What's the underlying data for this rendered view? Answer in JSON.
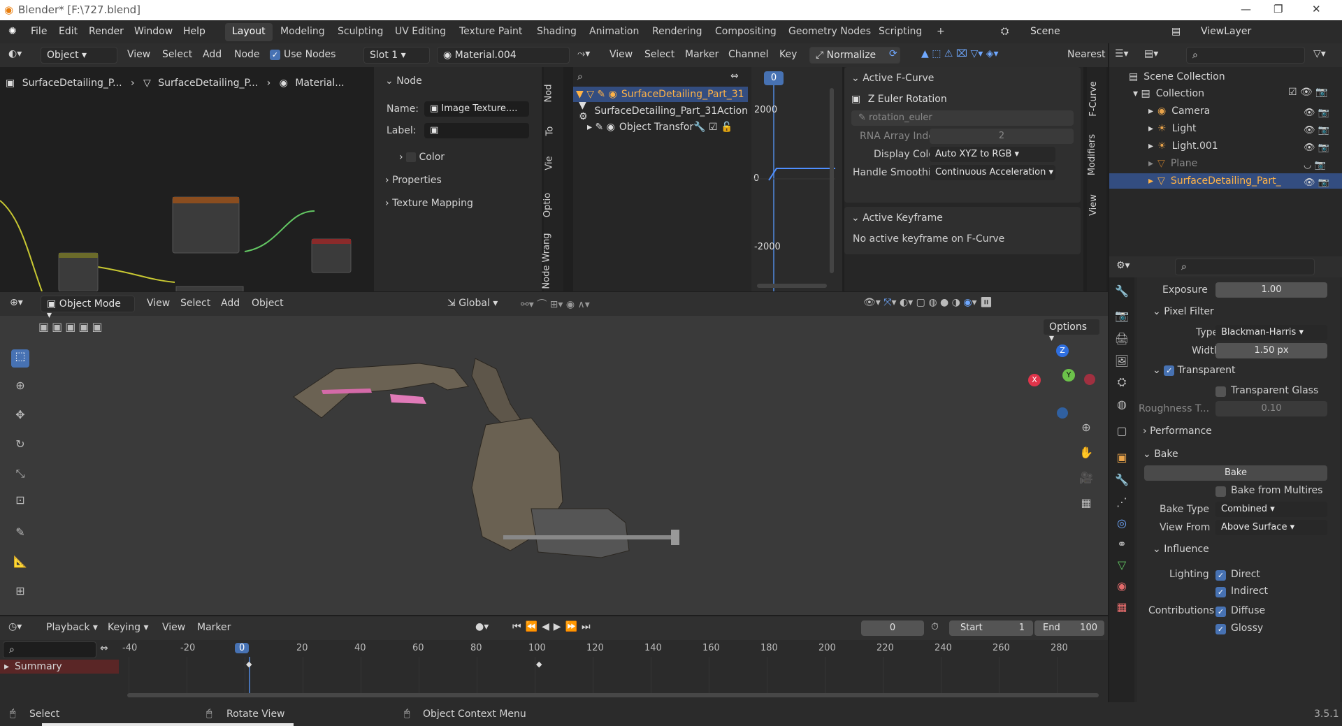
{
  "title": "Blender* [F:\\727.blend]",
  "menu": [
    "File",
    "Edit",
    "Render",
    "Window",
    "Help"
  ],
  "workspaces": [
    "Layout",
    "Modeling",
    "Sculpting",
    "UV Editing",
    "Texture Paint",
    "Shading",
    "Animation",
    "Rendering",
    "Compositing",
    "Geometry Nodes",
    "Scripting"
  ],
  "scene": "Scene",
  "view_layer": "ViewLayer",
  "node_editor": {
    "object_dd": "Object",
    "menus": [
      "View",
      "Select",
      "Add",
      "Node"
    ],
    "use_nodes": "Use Nodes",
    "slot": "Slot 1",
    "material": "Material.004",
    "breadcrumb": [
      "SurfaceDetailing_P...",
      "SurfaceDetailing_P...",
      "Material..."
    ],
    "panel_node": "Node",
    "name_label": "Name:",
    "name_value": "Image Texture....",
    "label_label": "Label:",
    "color": "Color",
    "properties": "Properties",
    "texture_mapping": "Texture Mapping",
    "tabs": [
      "Nod",
      "To",
      "Vie",
      "Optio",
      "Node Wrang"
    ]
  },
  "graph_editor": {
    "menus": [
      "View",
      "Select",
      "Marker",
      "Channel",
      "Key"
    ],
    "normalize": "Normalize",
    "interp": "Nearest",
    "channels": [
      "SurfaceDetailing_Part_31",
      "SurfaceDetailing_Part_31Action",
      "Object Transfor"
    ],
    "frame": "0",
    "y_ticks": [
      "2000",
      "0",
      "-2000"
    ],
    "active_fcurve": "Active F-Curve",
    "curve_name": "Z Euler Rotation",
    "data_path": "rotation_euler",
    "rna_label": "RNA Array Index",
    "rna_value": "2",
    "display_color_label": "Display Color",
    "display_color": "Auto XYZ to RGB",
    "handle_label": "Handle Smoothing",
    "handle_value": "Continuous Acceleration",
    "active_keyframe": "Active Keyframe",
    "no_keyframe": "No active keyframe on F-Curve",
    "tabs": [
      "F-Curve",
      "Modifiers",
      "View"
    ]
  },
  "outliner": {
    "root": "Scene Collection",
    "collection": "Collection",
    "items": [
      "Camera",
      "Light",
      "Light.001",
      "Plane",
      "SurfaceDetailing_Part_"
    ]
  },
  "properties": {
    "exposure_label": "Exposure",
    "exposure": "1.00",
    "pixel_filter": "Pixel Filter",
    "type_label": "Type",
    "type_value": "Blackman-Harris",
    "width_label": "Width",
    "width_value": "1.50 px",
    "transparent": "Transparent",
    "transparent_glass": "Transparent Glass",
    "roughness_label": "Roughness T...",
    "roughness": "0.10",
    "performance": "Performance",
    "bake_section": "Bake",
    "bake_button": "Bake",
    "bake_multires": "Bake from Multires",
    "bake_type_label": "Bake Type",
    "bake_type": "Combined",
    "view_from_label": "View From",
    "view_from": "Above Surface",
    "influence": "Influence",
    "lighting": "Lighting",
    "direct": "Direct",
    "indirect": "Indirect",
    "contributions": "Contributions",
    "diffuse": "Diffuse",
    "glossy": "Glossy"
  },
  "viewport": {
    "mode": "Object Mode",
    "menus": [
      "View",
      "Select",
      "Add",
      "Object"
    ],
    "orientation": "Global",
    "options": "Options"
  },
  "timeline": {
    "menus": [
      "Playback",
      "Keying",
      "View",
      "Marker"
    ],
    "current_frame": "0",
    "start_label": "Start",
    "start": "1",
    "end_label": "End",
    "end": "100",
    "summary": "Summary",
    "ticks": [
      "-40",
      "-20",
      "0",
      "20",
      "40",
      "60",
      "80",
      "100",
      "120",
      "140",
      "160",
      "180",
      "200",
      "220",
      "240",
      "260",
      "280"
    ]
  },
  "status": {
    "select": "Select",
    "rotate": "Rotate View",
    "context": "Object Context Menu",
    "version": "3.5.1"
  },
  "colors": {
    "accent": "#4772b3",
    "bg": "#1d1d1d",
    "header": "#2e2e2e",
    "selection": "#334d80"
  }
}
